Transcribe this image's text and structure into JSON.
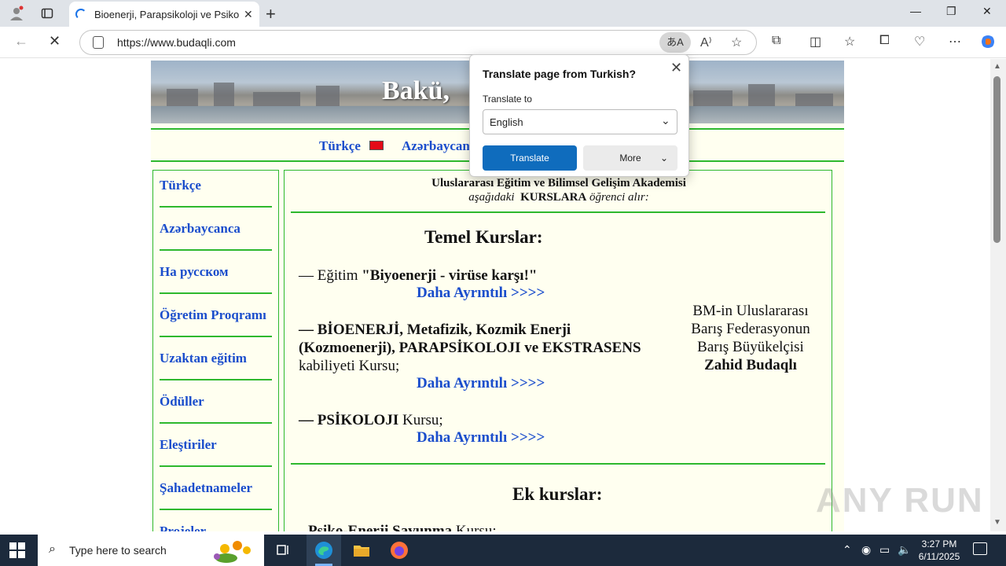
{
  "browser": {
    "tab_title": "Bioenerji, Parapsikoloji ve Psikoloj",
    "url": "https://www.budaqli.com",
    "new_tab_label": "+",
    "close_tab_label": "✕"
  },
  "translate_popup": {
    "title": "Translate page from Turkish?",
    "translate_to_label": "Translate to",
    "selected_language": "English",
    "translate_button": "Translate",
    "more_button": "More"
  },
  "site": {
    "banner_title": "Bakü,",
    "languages": [
      "Türkçe",
      "Azərbaycan"
    ],
    "sidebar_items": [
      "Türkçe",
      "Azərbaycanca",
      "На русском",
      "Öğretim Proqramı",
      "Uzaktan eğitim",
      "Ödüller",
      "Eleştiriler",
      "Şahadetnameler",
      "Projeler"
    ],
    "header_line1": "Uluslararası Eğitim ve Bilimsel Gelişim Akademisi",
    "header_line2_pre": "aşağıdaki",
    "header_line2_bold": "KURSLARA",
    "header_line2_post": "öğrenci alır:",
    "temel_heading": "Temel Kurslar:",
    "course1_prefix": "—  Eğitim ",
    "course1_bold": "\"Biyoenerji - virüse karşı!\"",
    "course2_bold": "—  BİOENERJİ, Metafizik, Kozmik Enerji (Kozmoenerji), PARAPSİKOLOJI ve EKSTRASENS",
    "course2_rest": "kabiliyeti Kursu;",
    "course3_bold": "—  PSİKOLOJI",
    "course3_rest": " Kursu;",
    "more_link": "Daha Ayrıntılı >>>>",
    "ambassador_line1": "BM-in Uluslararası",
    "ambassador_line2": "Barış Federasyonun",
    "ambassador_line3": "Barış Büyükelçisi",
    "ambassador_name": "Zahid Budaqlı",
    "ek_heading": "Ek kurslar:",
    "cut_line_bold": "Psiko-Enerji Savunma",
    "cut_line_rest": " Kursu;"
  },
  "watermark": "ANY RUN",
  "taskbar": {
    "search_placeholder": "Type here to search",
    "time": "3:27 PM",
    "date": "6/11/2025"
  },
  "colors": {
    "link_blue": "#1a4dcc",
    "green_rule": "#2eb82e",
    "translate_blue": "#0f6cbd",
    "taskbar": "#1c2a3c"
  }
}
